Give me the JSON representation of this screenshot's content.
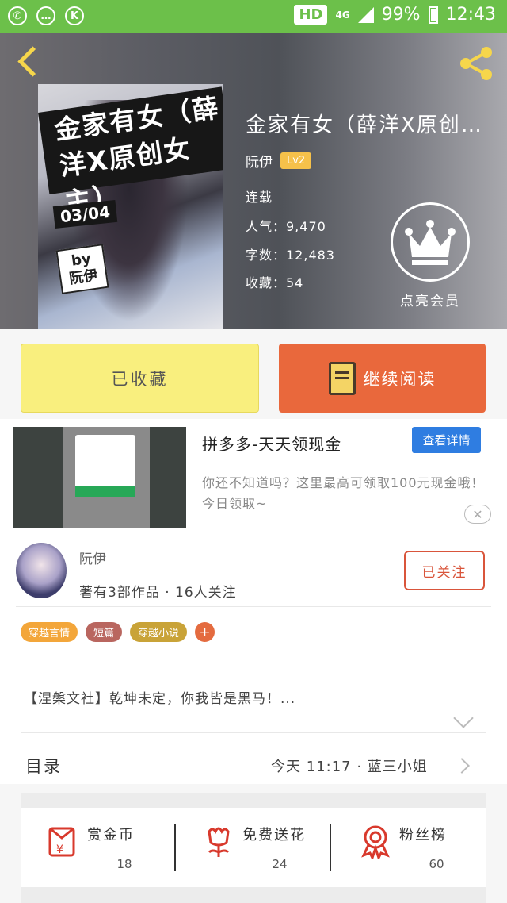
{
  "status_bar": {
    "hd": "HD",
    "network": "4G",
    "battery": "99%",
    "time": "12:43"
  },
  "book": {
    "cover_title": "金家有女（薛洋X原创女主）",
    "cover_issue": "03/04",
    "cover_by": "by",
    "cover_author": "阮伊",
    "title": "金家有女（薛洋X原创女...",
    "author": "阮伊",
    "level": "Lv2",
    "status": "连载",
    "popularity": "人气：9,470",
    "word_count": "字数：12,483",
    "favorites": "收藏：54",
    "vip_label": "点亮会员"
  },
  "actions": {
    "collected": "已收藏",
    "continue_reading": "继续阅读"
  },
  "ad": {
    "title": "拼多多-天天领现金",
    "button": "查看详情",
    "description": "你还不知道吗？这里最高可领取100元现金哦！今日领取~",
    "close": "✕"
  },
  "author": {
    "name": "阮伊",
    "stats": "著有3部作品 · 16人关注",
    "follow": "已关注"
  },
  "tags": [
    {
      "label": "穿越言情",
      "color": "#f3a63a"
    },
    {
      "label": "短篇",
      "color": "#b9665f"
    },
    {
      "label": "穿越小说",
      "color": "#c9a338"
    }
  ],
  "tag_add": "+",
  "intro": "【涅槃文社】乾坤未定，你我皆是黑马！...",
  "catalog": {
    "label": "目录",
    "update": "今天 11:17 · 蓝三小姐"
  },
  "rewards": [
    {
      "label": "赏金币",
      "count": "18"
    },
    {
      "label": "免费送花",
      "count": "24"
    },
    {
      "label": "粉丝榜",
      "count": "60"
    }
  ],
  "colors": {
    "status_green": "#6cc04a",
    "accent_orange": "#e9683c",
    "collected_yellow": "#f9ef7e",
    "follow_red": "#d9553b",
    "reward_red": "#d8392c"
  }
}
